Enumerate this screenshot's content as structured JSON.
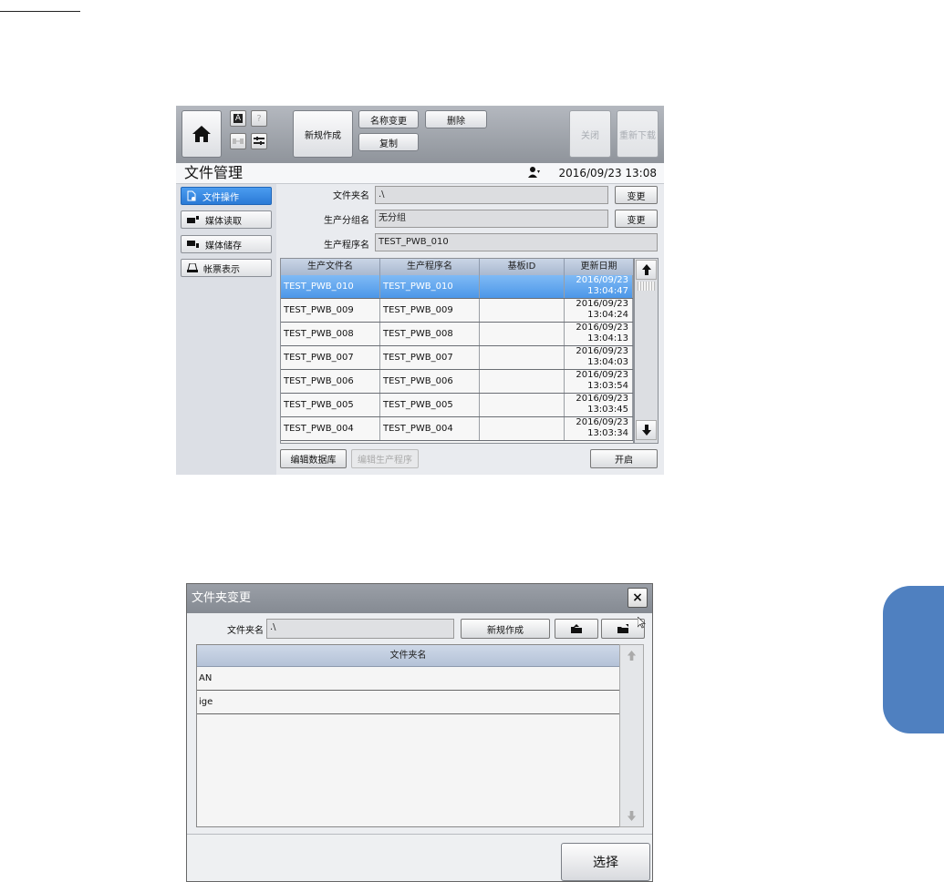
{
  "screen1": {
    "toolbar": {
      "new_label": "新规作成",
      "rename_label": "名称变更",
      "delete_label": "删除",
      "copy_label": "复制",
      "close_label": "关闭",
      "redownload_label": "重新下载",
      "help_glyph": "?",
      "a_glyph": "A"
    },
    "title": "文件管理",
    "datetime": "2016/09/23 13:08",
    "nav": [
      {
        "label": "文件操作",
        "active": true
      },
      {
        "label": "媒体读取",
        "active": false
      },
      {
        "label": "媒体储存",
        "active": false
      },
      {
        "label": "帐票表示",
        "active": false
      }
    ],
    "form": {
      "folder_label": "文件夹名",
      "folder_value": ".\\",
      "group_label": "生产分组名",
      "group_value": "无分组",
      "program_label": "生产程序名",
      "program_value": "TEST_PWB_010",
      "change_label": "变更"
    },
    "table": {
      "headers": [
        "生产文件名",
        "生产程序名",
        "基板ID",
        "更新日期"
      ],
      "rows": [
        {
          "file": "TEST_PWB_010",
          "program": "TEST_PWB_010",
          "board": "",
          "date": "2016/09/23",
          "time": "13:04:47",
          "selected": true
        },
        {
          "file": "TEST_PWB_009",
          "program": "TEST_PWB_009",
          "board": "",
          "date": "2016/09/23",
          "time": "13:04:24"
        },
        {
          "file": "TEST_PWB_008",
          "program": "TEST_PWB_008",
          "board": "",
          "date": "2016/09/23",
          "time": "13:04:13"
        },
        {
          "file": "TEST_PWB_007",
          "program": "TEST_PWB_007",
          "board": "",
          "date": "2016/09/23",
          "time": "13:04:03"
        },
        {
          "file": "TEST_PWB_006",
          "program": "TEST_PWB_006",
          "board": "",
          "date": "2016/09/23",
          "time": "13:03:54"
        },
        {
          "file": "TEST_PWB_005",
          "program": "TEST_PWB_005",
          "board": "",
          "date": "2016/09/23",
          "time": "13:03:45"
        },
        {
          "file": "TEST_PWB_004",
          "program": "TEST_PWB_004",
          "board": "",
          "date": "2016/09/23",
          "time": "13:03:34"
        }
      ]
    },
    "bottom": {
      "edit_db_label": "编辑数据库",
      "edit_program_label": "编辑生产程序",
      "open_label": "开启"
    }
  },
  "dialog": {
    "title": "文件夹变更",
    "close_glyph": "×",
    "folder_label": "文件夹名",
    "folder_value": ".\\",
    "new_label": "新规作成",
    "list_header": "文件夹名",
    "items": [
      "AN",
      "ige"
    ],
    "select_label": "选择"
  },
  "colors": {
    "accent": "#2a7ad6",
    "side_tab": "#4f80c0"
  }
}
